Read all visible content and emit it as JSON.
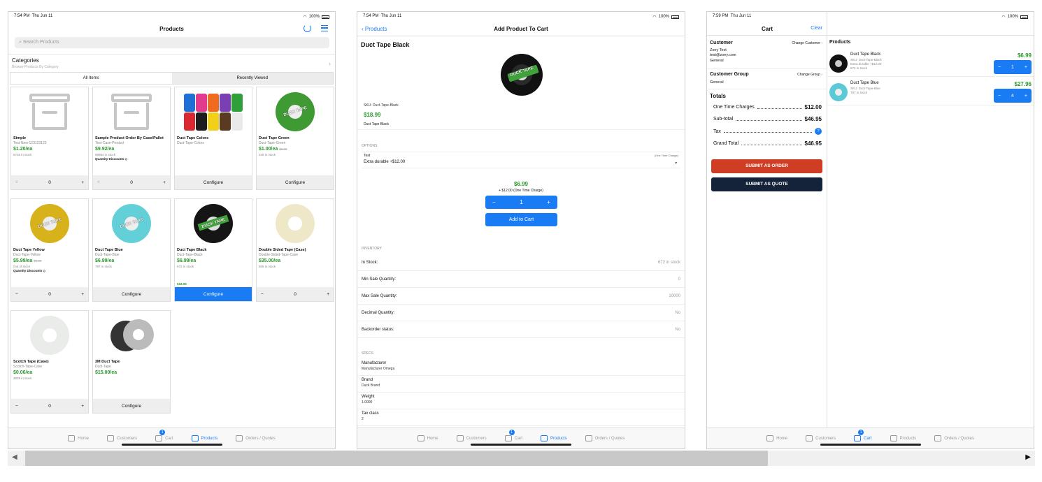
{
  "status1": {
    "time": "7:54 PM",
    "day": "Thu Jun 11",
    "battery": "100%"
  },
  "status3": {
    "time": "7:59 PM",
    "day": "Thu Jun 11",
    "battery": "100%"
  },
  "products": {
    "title": "Products",
    "search_placeholder": "Search Products",
    "categories_title": "Categories",
    "categories_sub": "Browse Products By Category",
    "seg_all": "All Items",
    "seg_recent": "Recently Viewed",
    "cards": [
      {
        "name": "Simple",
        "sku": "Test-New-123123123",
        "price": "$1.20/ea",
        "old": "",
        "stock": "6736 in stock",
        "qd": "",
        "footer": "stepper",
        "qty": "0"
      },
      {
        "name": "Sample Product Order By Case/Pallet",
        "sku": "Test-Case-Product",
        "price": "$9.92/ea",
        "old": "",
        "stock": "98984 in stock",
        "qd": "Quantity Discounts",
        "footer": "stepper",
        "qty": "0"
      },
      {
        "name": "Duct Tape Colors",
        "sku": "Duct-Tape-Colors",
        "price": "",
        "old": "",
        "stock": "",
        "qd": "",
        "footer": "configure",
        "qty": ""
      },
      {
        "name": "Duct Tape Green",
        "sku": "Duct-Tape-Green",
        "price": "$1.00/ea",
        "old": "$5.00",
        "stock": "248 in stock",
        "qd": "",
        "footer": "configure",
        "qty": ""
      },
      {
        "name": "Duct Tape Yellow",
        "sku": "Duct-Tape-Yellow",
        "price": "$5.99/ea",
        "old": "$6.00",
        "stock": "Out of stock",
        "qd": "Quantity Discounts",
        "footer": "stepper",
        "qty": "0"
      },
      {
        "name": "Duct Tape Blue",
        "sku": "Duct-Tape-Blue",
        "price": "$6.99/ea",
        "old": "",
        "stock": "797 in stock",
        "qd": "",
        "footer": "configure",
        "qty": ""
      },
      {
        "name": "Duct Tape Black",
        "sku": "Duct-Tape-Black",
        "price": "$6.99/ea",
        "old": "",
        "stock": "672 in stock",
        "qd": "",
        "footer": "configure-selected",
        "qty": "",
        "small": "$18.99"
      },
      {
        "name": "Double Sided Tape (Case)",
        "sku": "Double-Sided-Tape-Case",
        "price": "$35.00/ea",
        "old": "",
        "stock": "505 in stock",
        "qd": "",
        "footer": "stepper",
        "qty": "0"
      },
      {
        "name": "Scotch Tape (Case)",
        "sku": "Scotch-Tape-Case",
        "price": "$0.06/ea",
        "old": "",
        "stock": "4839 in stock",
        "qd": "",
        "footer": "stepper",
        "qty": "0"
      },
      {
        "name": "3M Duct Tape",
        "sku": "Duct-Tape",
        "price": "$15.00/ea",
        "old": "",
        "stock": "",
        "qd": "",
        "footer": "configure",
        "qty": ""
      }
    ],
    "configure_label": "Configure",
    "minus": "−",
    "plus": "+"
  },
  "tabs": {
    "home": "Home",
    "customers": "Customers",
    "cart": "Cart",
    "products": "Products",
    "orders": "Orders / Quotes",
    "cart_badge": "1"
  },
  "add": {
    "back": "Products",
    "title": "Add Product To Cart",
    "name": "Duct Tape Black",
    "image_label": "DUCK TAPE",
    "sku": "SKU: Duct-Tape-Black",
    "price": "$18.99",
    "desc": "Duct Tape Black",
    "options_header": "OPTIONS",
    "opt_label": "Test",
    "opt_charge": "(One Time Charge)",
    "opt_value": "Extra durable +$12.00",
    "total": "$6.99",
    "total_sub": "+ $12.00 (One Time Charge)",
    "qty": "1",
    "add_btn": "Add to Cart",
    "inventory_header": "INVENTORY",
    "inventory": [
      {
        "k": "In Stock:",
        "v": "672 in stock"
      },
      {
        "k": "Min Sale Quantity:",
        "v": "0"
      },
      {
        "k": "Max Sale Quantity:",
        "v": "10000"
      },
      {
        "k": "Decimal Quantity:",
        "v": "No"
      },
      {
        "k": "Backorder status:",
        "v": "No"
      }
    ],
    "specs_header": "SPECS",
    "specs": [
      {
        "k": "Manufacturer",
        "v": "Manufacturer Omega"
      },
      {
        "k": "Brand",
        "v": "Duck Brand"
      },
      {
        "k": "Weight",
        "v": "1.0000"
      },
      {
        "k": "Tax class",
        "v": "2"
      }
    ]
  },
  "cart": {
    "title": "Cart",
    "clear": "Clear",
    "customer_h": "Customer",
    "change_customer": "Change Customer",
    "cust_name": "Zoey Test",
    "cust_email": "test@zoey.com",
    "cust_group_small": "General",
    "group_h": "Customer Group",
    "change_group": "Change Group",
    "group_val": "General",
    "totals_h": "Totals",
    "totals": [
      {
        "k": "One Time Charges",
        "v": "$12.00"
      },
      {
        "k": "Sub-total",
        "v": "$46.95"
      },
      {
        "k": "Tax",
        "v": ""
      },
      {
        "k": "Grand Total",
        "v": "$46.95"
      }
    ],
    "tax_info": "?",
    "submit_order": "SUBMIT AS ORDER",
    "submit_quote": "SUBMIT AS QUOTE",
    "products_h": "Products",
    "items": [
      {
        "name": "Duct Tape Black",
        "d1": "SKU: Duct-Tape-Black",
        "d2": "Extra durable +$12.00",
        "d3": "672 in stock",
        "price": "$6.99",
        "qty": "1"
      },
      {
        "name": "Duct Tape Blue",
        "d1": "SKU: Duct-Tape-Blue",
        "d2": "797 in stock",
        "d3": "",
        "price": "$27.96",
        "qty": "4"
      }
    ]
  },
  "colors": {
    "accent": "#1a7cf4",
    "price_green": "#2a9a2a",
    "order_red": "#cf3d24",
    "quote_navy": "#15233a"
  }
}
